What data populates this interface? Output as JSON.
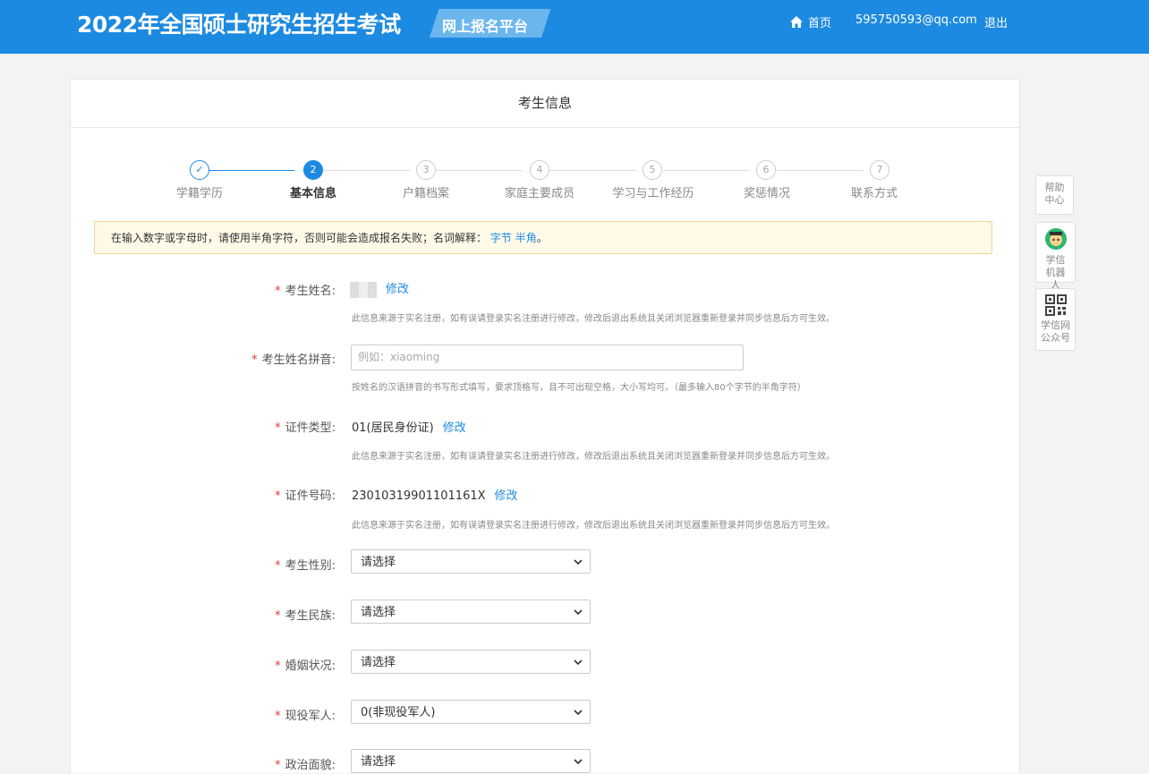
{
  "header": {
    "title": "2022年全国硕士研究生招生考试",
    "badge": "网上报名平台",
    "home": "首页",
    "email": "595750593@qq.com",
    "logout": "退出"
  },
  "card": {
    "title": "考生信息"
  },
  "steps": [
    {
      "num": "✓",
      "label": "学籍学历",
      "state": "done"
    },
    {
      "num": "2",
      "label": "基本信息",
      "state": "active"
    },
    {
      "num": "3",
      "label": "户籍档案",
      "state": "todo"
    },
    {
      "num": "4",
      "label": "家庭主要成员",
      "state": "todo"
    },
    {
      "num": "5",
      "label": "学习与工作经历",
      "state": "todo"
    },
    {
      "num": "6",
      "label": "奖惩情况",
      "state": "todo"
    },
    {
      "num": "7",
      "label": "联系方式",
      "state": "todo"
    }
  ],
  "notice": {
    "text": "在输入数字或字母时，请使用半角字符，否则可能会造成报名失败；名词解释：",
    "link1": "字节",
    "link2": "半角",
    "end": "。"
  },
  "form": {
    "required_mark": "*",
    "edit_label": "修改",
    "name": {
      "label": "考生姓名:",
      "hint": "此信息来源于实名注册，如有误请登录实名注册进行修改，修改后退出系统且关闭浏览器重新登录并同步信息后方可生效。"
    },
    "pinyin": {
      "label": "考生姓名拼音:",
      "placeholder": "例如：xiaoming",
      "hint": "按姓名的汉语拼音的书写形式填写，要求顶格写，且不可出现空格，大小写均可。（最多输入80个字节的半角字符）"
    },
    "id_type": {
      "label": "证件类型:",
      "value": "01(居民身份证)",
      "hint": "此信息来源于实名注册，如有误请登录实名注册进行修改，修改后退出系统且关闭浏览器重新登录并同步信息后方可生效。"
    },
    "id_number": {
      "label": "证件号码:",
      "value": "23010319901101161X",
      "hint": "此信息来源于实名注册，如有误请登录实名注册进行修改，修改后退出系统且关闭浏览器重新登录并同步信息后方可生效。"
    },
    "gender": {
      "label": "考生性别:",
      "value": "请选择"
    },
    "ethnicity": {
      "label": "考生民族:",
      "value": "请选择"
    },
    "marital": {
      "label": "婚姻状况:",
      "value": "请选择"
    },
    "military": {
      "label": "现役军人:",
      "value": "0(非现役军人)"
    },
    "political": {
      "label": "政治面貌:",
      "value": "请选择"
    }
  },
  "sidebar": {
    "help": "帮助中心",
    "robot": "学信机器人",
    "wechat": "学信网公众号"
  },
  "colors": {
    "brand": "#1d8ae1",
    "required": "#e53935"
  }
}
